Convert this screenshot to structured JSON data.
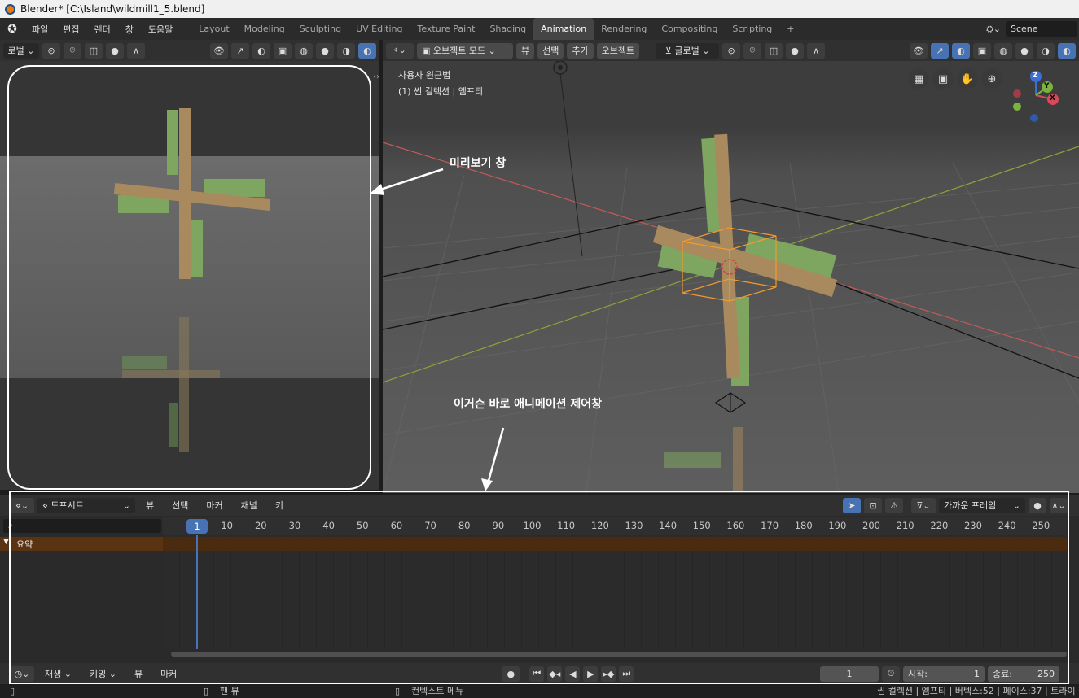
{
  "window": {
    "title": "Blender* [C:\\Island\\wildmill1_5.blend]"
  },
  "menu": {
    "items": [
      "파일",
      "편집",
      "렌더",
      "창",
      "도움말"
    ]
  },
  "workspaces": {
    "tabs": [
      "Layout",
      "Modeling",
      "Sculpting",
      "UV Editing",
      "Texture Paint",
      "Shading",
      "Animation",
      "Rendering",
      "Compositing",
      "Scripting"
    ],
    "active": "Animation",
    "add": "+"
  },
  "scene": {
    "name": "Scene"
  },
  "left_view": {
    "orientation": "로벌"
  },
  "viewport": {
    "mode": "오브젝트 모드",
    "menu": [
      "뷰",
      "선택",
      "추가",
      "오브젝트"
    ],
    "transform": "글로벌",
    "overlay_title": "사용자 원근법",
    "overlay_sub": "(1) 씬 컬렉션 | 엠프티",
    "gizmo": {
      "z": "Z",
      "y": "Y",
      "x": "X"
    }
  },
  "annotations": {
    "preview": "미리보기 창",
    "timeline": "이거슨 바로 애니메이션 제어창"
  },
  "dopesheet": {
    "mode": "도프시트",
    "menu": [
      "뷰",
      "선택",
      "마커",
      "채널",
      "키"
    ],
    "snap": "가까운 프레임",
    "current_frame": "1",
    "ticks": [
      "10",
      "20",
      "30",
      "40",
      "50",
      "60",
      "70",
      "80",
      "90",
      "100",
      "110",
      "120",
      "130",
      "140",
      "150",
      "160",
      "170",
      "180",
      "190",
      "200",
      "210",
      "220",
      "230",
      "240",
      "250"
    ],
    "summary": "요약"
  },
  "playback": {
    "menu": [
      "재생",
      "키잉",
      "뷰",
      "마커"
    ],
    "frame": "1",
    "start_label": "시작:",
    "start": "1",
    "end_label": "종료:",
    "end": "250"
  },
  "status": {
    "pan": "팬 뷰",
    "context": "컨텍스트 메뉴",
    "stats": "씬 컬렉션 | 엠프티 | 버텍스:52 | 페이스:37 | 트라이"
  },
  "colors": {
    "accent": "#4772b3",
    "summary_row": "#5a3312",
    "select_outline": "#f39a2c"
  }
}
